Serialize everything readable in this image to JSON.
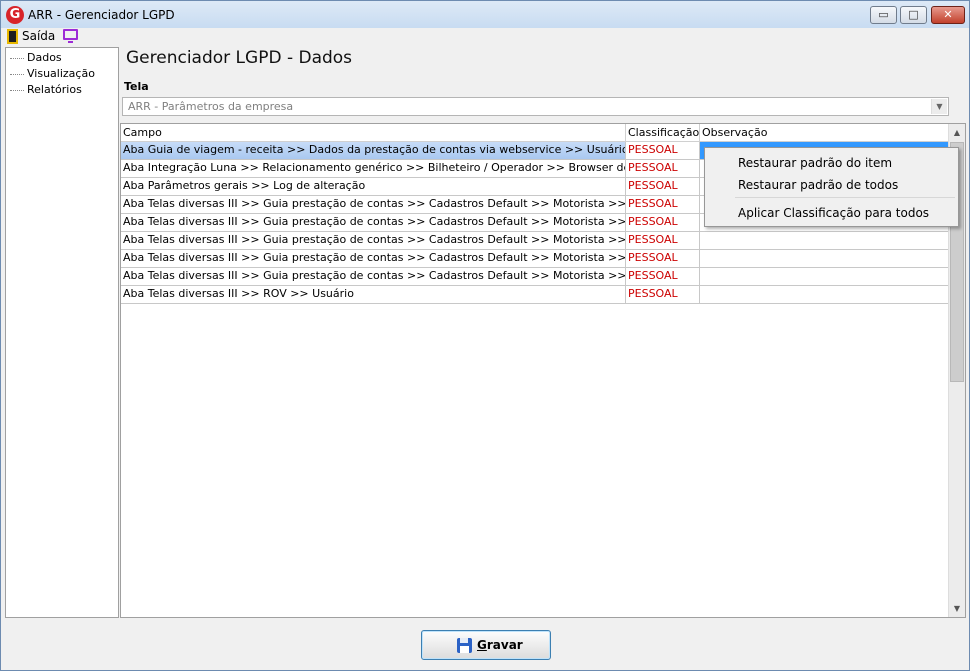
{
  "window": {
    "title": "ARR - Gerenciador LGPD",
    "logo_letter": "G",
    "min_symbol": "▭",
    "max_symbol": "□",
    "close_symbol": "✕"
  },
  "menu": {
    "exit_label": "Saída",
    "exit_icon": "door-icon",
    "monitor_icon": "monitor-icon"
  },
  "sidebar": {
    "items": [
      {
        "label": "Dados"
      },
      {
        "label": "Visualização"
      },
      {
        "label": "Relatórios"
      }
    ]
  },
  "page": {
    "title": "Gerenciador LGPD - Dados",
    "tela_label": "Tela",
    "tela_value": "ARR - Parâmetros da empresa"
  },
  "grid": {
    "columns": [
      "Campo",
      "Classificação",
      "Observação"
    ],
    "rows": [
      {
        "campo": "Aba Guia de viagem - receita >> Dados da prestação de contas via webservice >> Usuário",
        "classificacao": "PESSOAL",
        "observacao": ""
      },
      {
        "campo": "Aba Integração Luna >> Relacionamento genérico >> Bilheteiro / Operador >> Browser de pesquisa >> ...",
        "classificacao": "PESSOAL",
        "observacao": ""
      },
      {
        "campo": "Aba Parâmetros gerais >> Log de alteração",
        "classificacao": "PESSOAL",
        "observacao": ""
      },
      {
        "campo": "Aba Telas diversas III >> Guia prestação de contas >> Cadastros Default >> Motorista >> Browser de pe...",
        "classificacao": "PESSOAL",
        "observacao": ""
      },
      {
        "campo": "Aba Telas diversas III >> Guia prestação de contas >> Cadastros Default >> Motorista >> Browser de pe...",
        "classificacao": "PESSOAL",
        "observacao": ""
      },
      {
        "campo": "Aba Telas diversas III >> Guia prestação de contas >> Cadastros Default >> Motorista >> Browser de pe...",
        "classificacao": "PESSOAL",
        "observacao": ""
      },
      {
        "campo": "Aba Telas diversas III >> Guia prestação de contas >> Cadastros Default >> Motorista >> Browser de pe...",
        "classificacao": "PESSOAL",
        "observacao": ""
      },
      {
        "campo": "Aba Telas diversas III >> Guia prestação de contas >> Cadastros Default >> Motorista >> Browser de pe...",
        "classificacao": "PESSOAL",
        "observacao": ""
      },
      {
        "campo": "Aba Telas diversas III >> ROV >> Usuário",
        "classificacao": "PESSOAL",
        "observacao": ""
      }
    ]
  },
  "context_menu": {
    "items": [
      "Restaurar padrão do item",
      "Restaurar padrão de todos",
      "Aplicar Classificação para todos"
    ]
  },
  "footer": {
    "save_label": "Gravar",
    "save_underline": "G",
    "save_rest": "ravar"
  },
  "colors": {
    "classification": "#cc0000",
    "selection": "#a9c8f0",
    "accent": "#3399ff"
  }
}
